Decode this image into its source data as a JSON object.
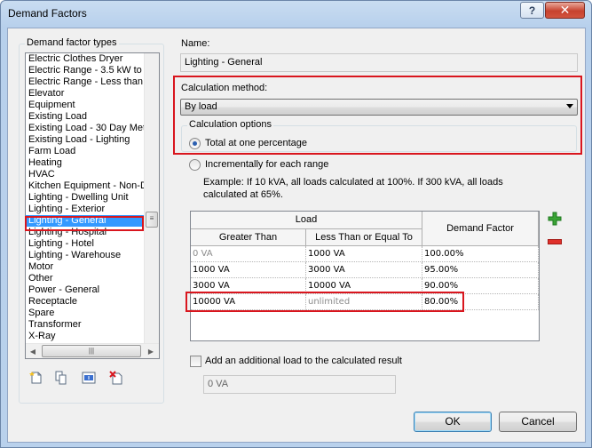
{
  "window": {
    "title": "Demand Factors",
    "help_glyph": "?",
    "close_glyph": "✕"
  },
  "types": {
    "label": "Demand factor types",
    "items": [
      "Electric Clothes Dryer",
      "Electric Range - 3.5 kW to",
      "Electric Range - Less than",
      "Elevator",
      "Equipment",
      "Existing Load",
      "Existing Load - 30 Day Met",
      "Existing Load - Lighting",
      "Farm Load",
      "Heating",
      "HVAC",
      "Kitchen Equipment - Non-D",
      "Lighting - Dwelling Unit",
      "Lighting - Exterior",
      "Lighting - General",
      "Lighting - Hospital",
      "Lighting - Hotel",
      "Lighting - Warehouse",
      "Motor",
      "Other",
      "Power - General",
      "Receptacle",
      "Spare",
      "Transformer",
      "X-Ray"
    ],
    "selected": "Lighting - General"
  },
  "name": {
    "label": "Name:",
    "value": "Lighting - General"
  },
  "calculation": {
    "method_label": "Calculation method:",
    "method_value": "By load",
    "options_label": "Calculation options",
    "option_total": "Total at one percentage",
    "option_incremental": "Incrementally for each range",
    "example": "Example: If 10 kVA, all loads calculated at 100%. If 300 kVA, all loads calculated at 65%."
  },
  "grid": {
    "group_header": "Load",
    "col_greater": "Greater Than",
    "col_less": "Less Than or Equal To",
    "col_factor": "Demand Factor",
    "rows": [
      {
        "greater": "0 VA",
        "less": "1000 VA",
        "factor": "100.00%"
      },
      {
        "greater": "1000 VA",
        "less": "3000 VA",
        "factor": "95.00%"
      },
      {
        "greater": "3000 VA",
        "less": "10000 VA",
        "factor": "90.00%"
      },
      {
        "greater": "10000 VA",
        "less": "unlimited",
        "factor": "80.00%"
      }
    ]
  },
  "additional": {
    "label": "Add an additional load to the calculated result",
    "value": "0 VA"
  },
  "buttons": {
    "ok": "OK",
    "cancel": "Cancel"
  },
  "colors": {
    "highlight": "#d9161e",
    "selection": "#3399ff",
    "add": "#3aa335",
    "remove": "#e0302a"
  }
}
